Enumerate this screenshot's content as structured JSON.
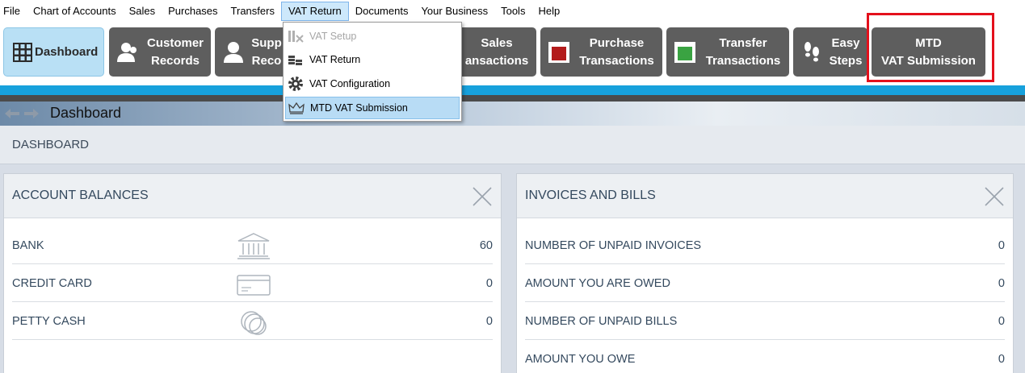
{
  "menu": [
    "File",
    "Chart of Accounts",
    "Sales",
    "Purchases",
    "Transfers",
    "VAT Return",
    "Documents",
    "Your Business",
    "Tools",
    "Help"
  ],
  "toolbar": {
    "dashboard": "Dashboard",
    "customer_1": "Customer",
    "customer_2": "Records",
    "supplier_1": "Supp",
    "supplier_2": "Reco",
    "sales_1": "Sales",
    "sales_2": "ansactions",
    "purchase_1": "Purchase",
    "purchase_2": "Transactions",
    "transfer_1": "Transfer",
    "transfer_2": "Transactions",
    "easy_1": "Easy",
    "easy_2": "Steps",
    "mtd_1": "MTD",
    "mtd_2": "VAT Submission"
  },
  "vat_menu": {
    "setup": "VAT Setup",
    "return": "VAT Return",
    "configuration": "VAT Configuration",
    "mtd": "MTD VAT Submission"
  },
  "page_title": "Dashboard",
  "breadcrumb": "DASHBOARD",
  "account_balances": {
    "title": "ACCOUNT BALANCES",
    "rows": [
      {
        "label": "BANK",
        "value": "60"
      },
      {
        "label": "CREDIT CARD",
        "value": "0"
      },
      {
        "label": "PETTY CASH",
        "value": "0"
      }
    ]
  },
  "invoices_bills": {
    "title": "INVOICES AND BILLS",
    "rows": [
      {
        "label": "NUMBER OF UNPAID INVOICES",
        "value": "0"
      },
      {
        "label": "AMOUNT YOU ARE OWED",
        "value": "0"
      },
      {
        "label": "NUMBER OF UNPAID BILLS",
        "value": "0"
      },
      {
        "label": "AMOUNT YOU OWE",
        "value": "0"
      }
    ]
  },
  "colors": {
    "accent": "#17a1dc",
    "highlight": "#e3101c",
    "button": "#5e5e5e"
  }
}
